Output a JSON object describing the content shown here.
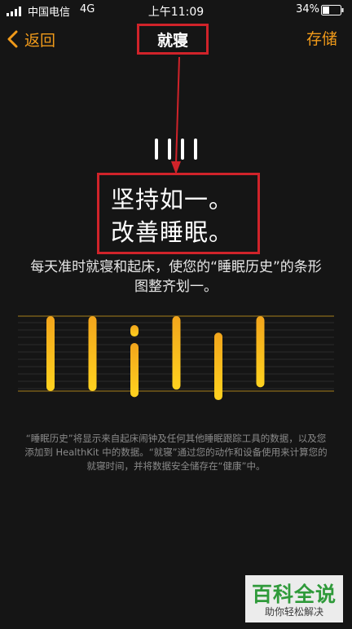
{
  "status_bar": {
    "carrier": "中国电信",
    "network": "4G",
    "time": "上午11:09",
    "battery": "34%"
  },
  "nav": {
    "back_label": "返回",
    "title": "就寝",
    "save_label": "存储"
  },
  "headline": {
    "line1": "坚持如一。",
    "line2": "改善睡眠。"
  },
  "description": "每天准时就寝和起床，使您的“睡眠历史”的条形图整齐划一。",
  "footnote": "“睡眠历史”将显示来自起床闹钟及任何其他睡眠跟踪工具的数据，以及您添加到 HealthKit 中的数据。“就寝”通过您的动作和设备使用来计算您的就寝时间，并将数据安全储存在“健康”中。",
  "watermark": {
    "title": "百科全说",
    "subtitle": "助你轻松解决"
  },
  "colors": {
    "accent": "#f09a1a",
    "annotation": "#d0232a",
    "bar_top": "#f2a51c",
    "bar_bottom": "#ffd21f"
  },
  "chart_data": {
    "type": "bar",
    "note": "floating bars representing sleep intervals, relative to two reference lines",
    "bars": [
      {
        "start": 0.0,
        "end": 1.0
      },
      {
        "start": 0.0,
        "end": 1.0
      },
      {
        "start": 0.12,
        "end": 1.08,
        "gap_dot": true
      },
      {
        "start": 0.0,
        "end": 0.98
      },
      {
        "start": 0.22,
        "end": 1.12
      },
      {
        "start": 0.0,
        "end": 0.95
      }
    ]
  }
}
